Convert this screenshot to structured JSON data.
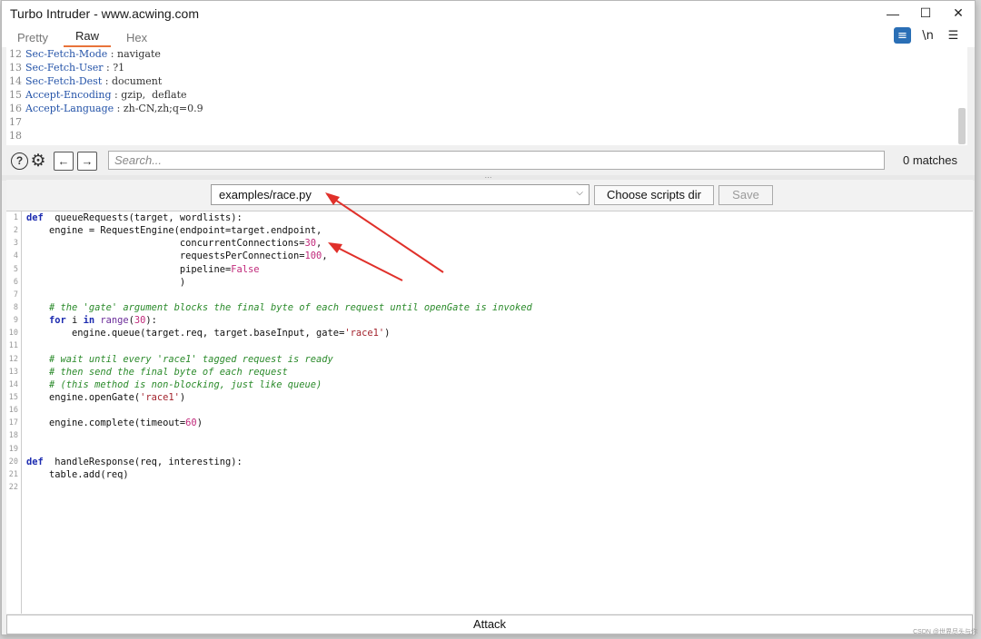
{
  "window": {
    "title": "Turbo Intruder - www.acwing.com"
  },
  "tabs": [
    "Pretty",
    "Raw",
    "Hex"
  ],
  "active_tab": "Raw",
  "toolbar": {
    "wrap_icon": "wrap-lines-icon",
    "newline_label": "\\n",
    "menu_icon": "hamburger-menu-icon"
  },
  "raw_lines": [
    {
      "n": "12",
      "k": "Sec-Fetch-Mode",
      "v": " : navigate"
    },
    {
      "n": "13",
      "k": "Sec-Fetch-User",
      "v": " : ?1"
    },
    {
      "n": "14",
      "k": "Sec-Fetch-Dest",
      "v": " : document"
    },
    {
      "n": "15",
      "k": "Accept-Encoding",
      "v": " : gzip,  deflate"
    },
    {
      "n": "16",
      "k": "Accept-Language",
      "v": " : zh-CN,zh;q=0.9"
    },
    {
      "n": "17",
      "k": "",
      "v": ""
    },
    {
      "n": "18",
      "k": "",
      "v": ""
    }
  ],
  "search": {
    "placeholder": "Search...",
    "matches": "0 matches"
  },
  "script_select": {
    "value": "examples/race.py",
    "choose_label": "Choose scripts dir",
    "save_label": "Save"
  },
  "code_lines": [
    "1",
    "2",
    "3",
    "4",
    "5",
    "6",
    "7",
    "8",
    "9",
    "10",
    "11",
    "12",
    "13",
    "14",
    "15",
    "16",
    "17",
    "18",
    "19",
    "20",
    "21",
    "22"
  ],
  "attack_label": "Attack",
  "watermark": "CSDN @世界尽头与你",
  "colors": {
    "accent": "#e8733a",
    "keyword": "#1c2bb0",
    "comment": "#2a8a2a",
    "number": "#c0287a",
    "annotation": "#e0302a"
  }
}
